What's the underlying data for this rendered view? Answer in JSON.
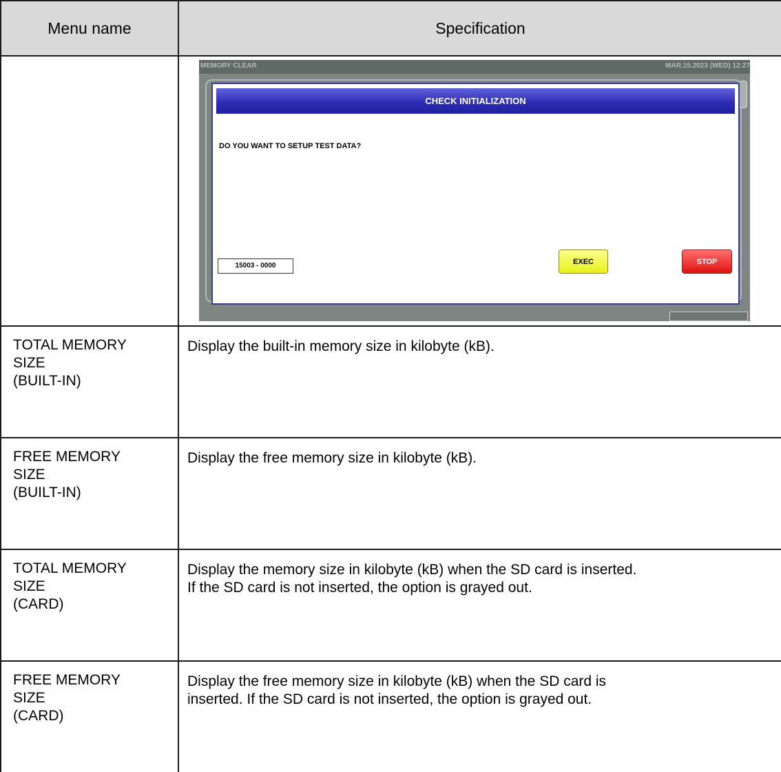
{
  "table": {
    "header": {
      "col1": "Menu name",
      "col2": "Specification"
    },
    "rows": [
      {
        "name": [
          "TOTAL MEMORY",
          "SIZE",
          "(BUILT-IN)"
        ],
        "desc": [
          "Display the built-in memory size in kilobyte (kB)."
        ]
      },
      {
        "name": [
          "FREE MEMORY",
          "SIZE",
          "(BUILT-IN)"
        ],
        "desc": [
          "Display the free memory size in kilobyte (kB)."
        ]
      },
      {
        "name": [
          "TOTAL MEMORY",
          "SIZE",
          "(CARD)"
        ],
        "desc": [
          "Display the memory size in kilobyte (kB) when the SD card is inserted.",
          "If the SD card is not inserted, the option is grayed out."
        ]
      },
      {
        "name": [
          "FREE MEMORY",
          "SIZE",
          "(CARD)"
        ],
        "desc": [
          "Display the free memory size in kilobyte (kB) when the SD card is",
          "inserted. If the SD card is not inserted, the option is grayed out."
        ]
      }
    ]
  },
  "screen": {
    "title": "MEMORY CLEAR",
    "datetime": "MAR.15.2023 (WED)  12:27",
    "dialog": {
      "title": "CHECK INITIALIZATION",
      "message": "DO YOU WANT TO SETUP TEST DATA?",
      "code": "15003 - 0000",
      "exec_label": "EXEC",
      "stop_label": "STOP"
    },
    "colors": {
      "dialog_title": "#2e2eb6",
      "exec": "#e8f21a",
      "stop": "#e01010",
      "frame": "#7f8583"
    }
  }
}
